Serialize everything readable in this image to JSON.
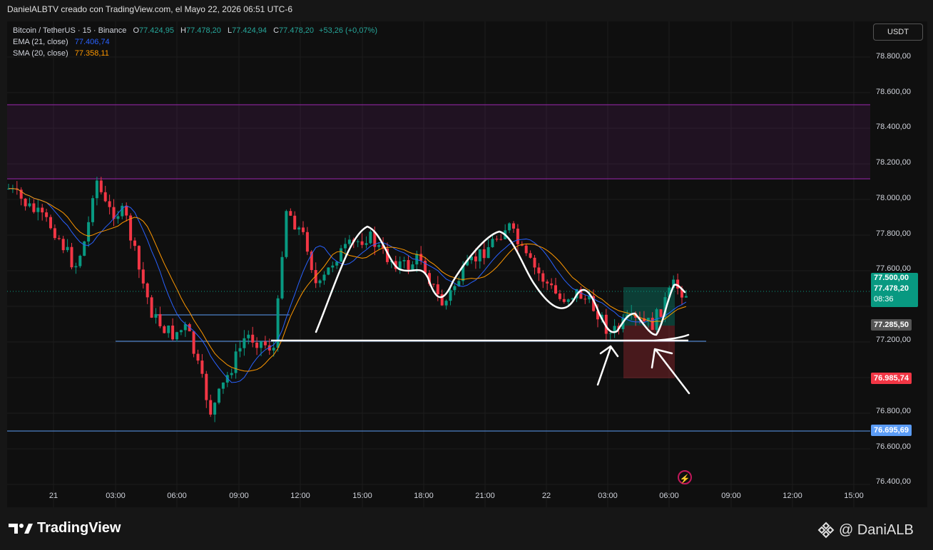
{
  "header": {
    "caption": "DanielALBTV creado con TradingView.com, el Mayo 22, 2026 06:51 UTC-6"
  },
  "legend": {
    "symbol": "Bitcoin / TetherUS · 15 · Binance",
    "o_label": "O",
    "o": "77.424,95",
    "h_label": "H",
    "h": "77.478,20",
    "l_label": "L",
    "l": "77.424,94",
    "c_label": "C",
    "c": "77.478,20",
    "change": "+53,26 (+0,07%)",
    "ema_label": "EMA (21, close)",
    "ema_value": "77.406,74",
    "sma_label": "SMA (20, close)",
    "sma_value": "77.358,11"
  },
  "currency_button": "USDT",
  "price_axis": [
    "78.800,00",
    "78.600,00",
    "78.400,00",
    "78.200,00",
    "78.000,00",
    "77.800,00",
    "77.600,00",
    "77.200,00",
    "76.800,00",
    "76.600,00",
    "76.400,00"
  ],
  "time_axis": [
    "21",
    "03:00",
    "06:00",
    "09:00",
    "12:00",
    "15:00",
    "18:00",
    "21:00",
    "22",
    "03:00",
    "06:00",
    "09:00",
    "12:00",
    "15:00"
  ],
  "badges": {
    "target": "77.500,00",
    "current_price": "77.478,20",
    "countdown": "08:36",
    "entry": "77.285,50",
    "stop": "76.985,74",
    "blue_line": "76.695,69"
  },
  "colors": {
    "up": "#089981",
    "down": "#f23645",
    "ema": "#2962ff",
    "sma": "#ff9800",
    "zone": "#9c27b0",
    "stop": "#f23645",
    "target": "#089981",
    "blue_line": "#5b9cf6"
  },
  "footer": {
    "brand": "TradingView",
    "author": "@ DaniALB"
  },
  "icons": [
    "tradingview-logo-icon",
    "binance-logo-icon",
    "flash-icon"
  ]
}
